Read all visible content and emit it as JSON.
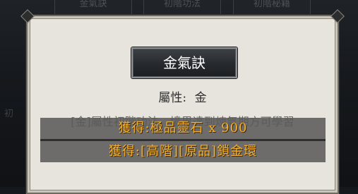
{
  "background": {
    "tabs": [
      "金氣訣",
      "初階功法",
      "初階秘籍"
    ],
    "fragment_left": "初"
  },
  "dialog": {
    "skill_name": "金氣訣",
    "attribute_label": "屬性:",
    "attribute_value": "金",
    "description": "[金]屬性初階功法，境界達到煉氣期方可學習"
  },
  "rewards": [
    {
      "text": "獲得:極品靈石 x 900"
    },
    {
      "text": "獲得:[高階][原品]鎖金環"
    }
  ],
  "colors": {
    "panel": "#e6e4dd",
    "reward_text": "#f4b02c",
    "title_plate": "#262a2e"
  }
}
